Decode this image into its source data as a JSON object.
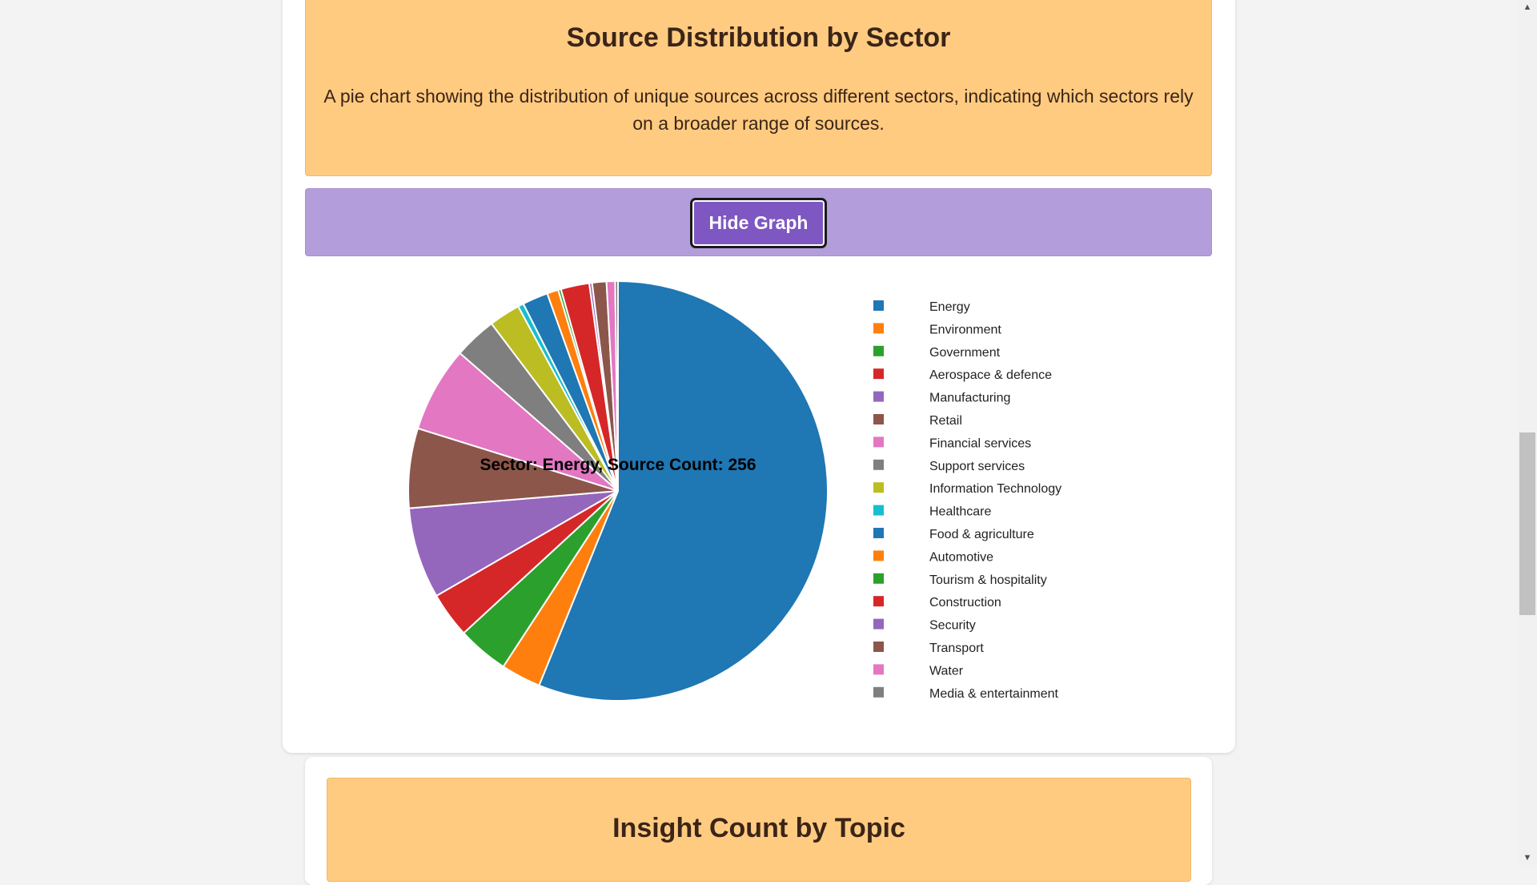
{
  "section": {
    "title": "Source Distribution by Sector",
    "description": "A pie chart showing the distribution of unique sources across different sectors, indicating which sectors rely on a broader range of sources."
  },
  "toggle_button": {
    "label": "Hide Graph"
  },
  "next_section": {
    "title": "Insight Count by Topic"
  },
  "tooltip": {
    "text": "Sector: Energy, Source Count: 256"
  },
  "colors": {
    "palette": [
      "#1f77b4",
      "#ff7f0e",
      "#2ca02c",
      "#d62728",
      "#9467bd",
      "#8c564b",
      "#e377c2",
      "#7f7f7f",
      "#bcbd22",
      "#17becf"
    ]
  },
  "chart_data": {
    "type": "pie",
    "title": "",
    "legend_position": "right",
    "categories": [
      "Energy",
      "Environment",
      "Government",
      "Aerospace & defence",
      "Manufacturing",
      "Retail",
      "Financial services",
      "Support services",
      "Information Technology",
      "Healthcare",
      "Food & agriculture",
      "Automotive",
      "Tourism & hospitality",
      "Construction",
      "Security",
      "Transport",
      "Water",
      "Media & entertainment"
    ],
    "values": [
      256,
      14,
      18,
      16,
      32,
      28,
      30,
      15,
      11,
      2,
      9,
      4,
      1,
      10,
      1,
      5,
      3,
      1
    ]
  }
}
